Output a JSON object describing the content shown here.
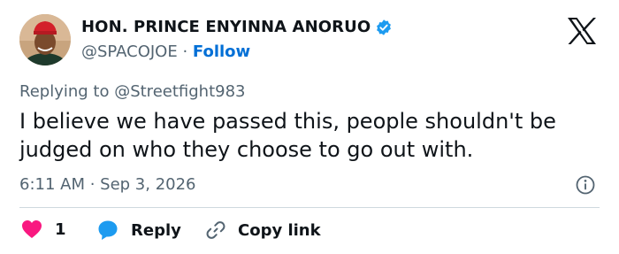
{
  "author": {
    "name": "HON. PRINCE ENYINNA ANORUO",
    "handle": "@SPACOJOE",
    "separator": "·",
    "follow_label": "Follow"
  },
  "icons": {
    "verified": "verified-badge-icon",
    "platform": "x-logo-icon",
    "info": "info-icon",
    "like": "heart-icon",
    "reply": "speech-bubble-icon",
    "copy": "link-icon"
  },
  "tweet": {
    "replying_to": "Replying to @Streetfight983",
    "text": "I believe we have passed this, people shouldn't be judged on who they choose to go out with.",
    "timestamp": "6:11 AM · Sep 3, 2026"
  },
  "actions": {
    "like_count": "1",
    "reply_label": "Reply",
    "copy_label": "Copy link"
  },
  "colors": {
    "accent": "#006fd6",
    "verified": "#1d9bf0",
    "like": "#f91880",
    "reply": "#1d9bf0",
    "text": "#0f1419",
    "muted": "#536471",
    "divider": "#cfd9de"
  }
}
